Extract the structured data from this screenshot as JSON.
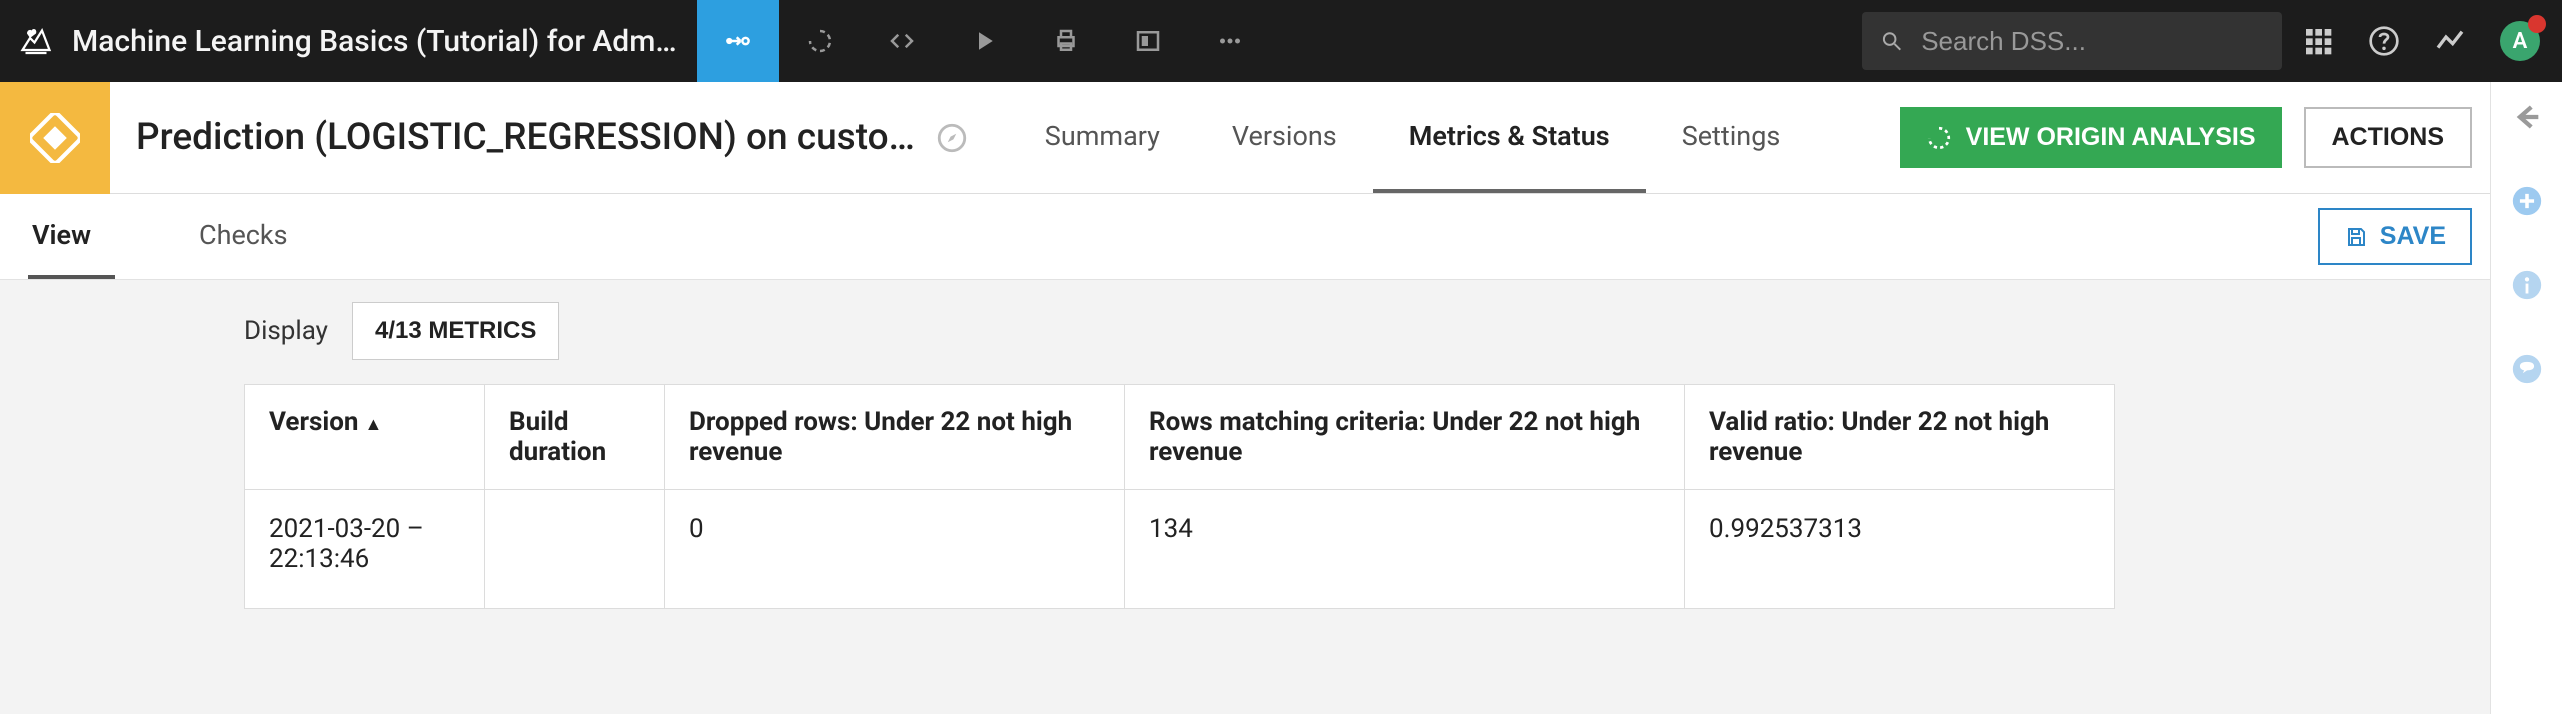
{
  "header": {
    "project_title": "Machine Learning Basics (Tutorial) for Adm…",
    "search_placeholder": "Search DSS...",
    "avatar_initial": "A"
  },
  "object": {
    "title": "Prediction (LOGISTIC_REGRESSION) on custo…",
    "tabs": {
      "summary": "Summary",
      "versions": "Versions",
      "metrics": "Metrics & Status",
      "settings": "Settings"
    },
    "origin_button": "VIEW ORIGIN ANALYSIS",
    "actions_button": "ACTIONS"
  },
  "subtabs": {
    "view": "View",
    "checks": "Checks",
    "save": "SAVE"
  },
  "metrics_panel": {
    "display_label": "Display",
    "metrics_button": "4/13 METRICS",
    "columns": {
      "version": "Version",
      "build_duration": "Build duration",
      "dropped": "Dropped rows: Under 22 not high revenue",
      "matching": "Rows matching criteria: Under 22 not high revenue",
      "valid": "Valid ratio: Under 22 not high revenue"
    },
    "rows": [
      {
        "version": "2021-03-20 – 22:13:46",
        "build_duration": "",
        "dropped": "0",
        "matching": "134",
        "valid": "0.992537313"
      }
    ]
  }
}
